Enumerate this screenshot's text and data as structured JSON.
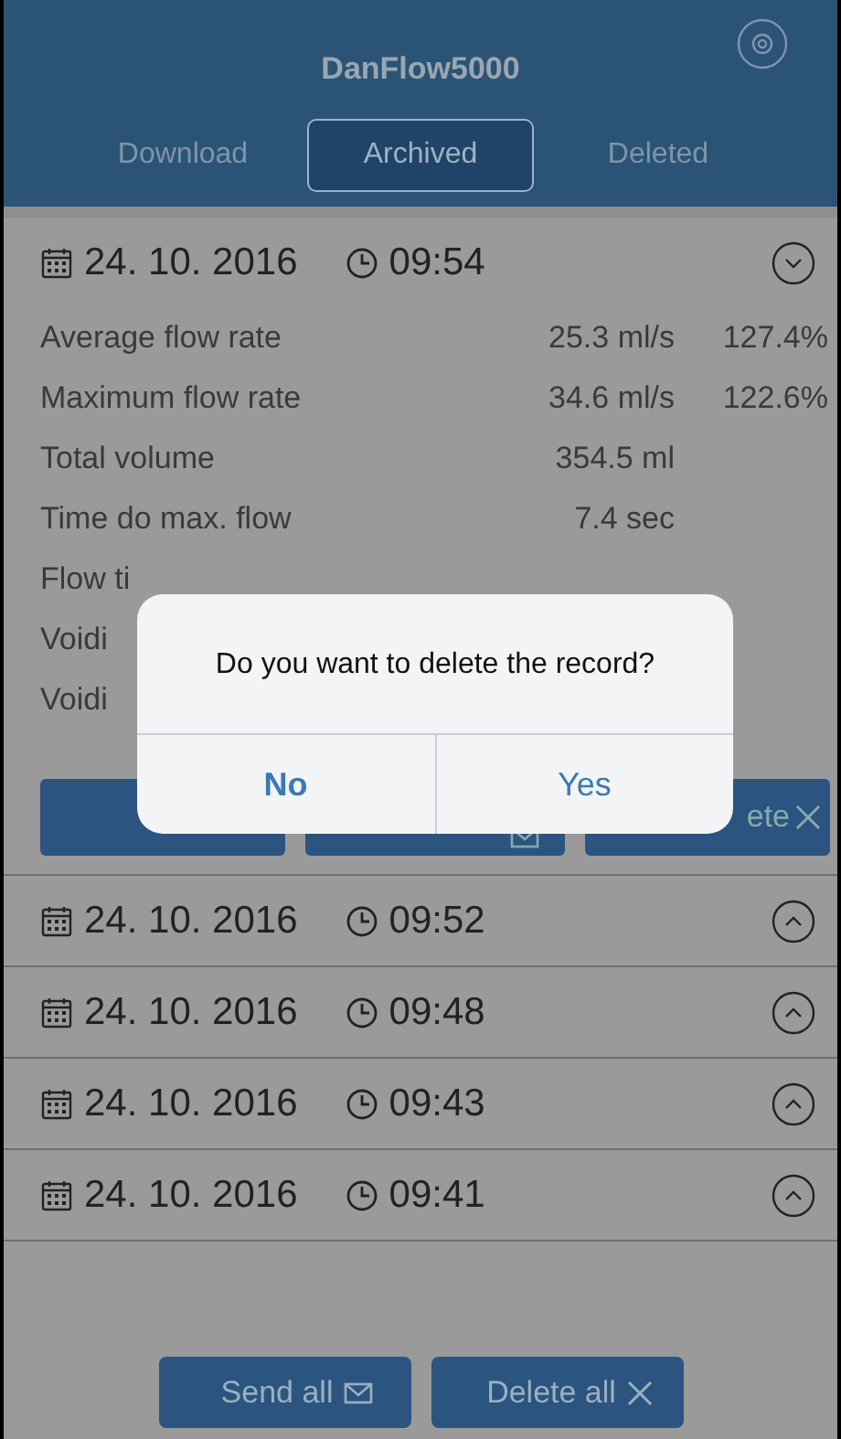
{
  "app": {
    "title": "DanFlow5000"
  },
  "tabs": [
    {
      "label": "Download",
      "selected": false
    },
    {
      "label": "Archived",
      "selected": true
    },
    {
      "label": "Deleted",
      "selected": false
    }
  ],
  "records": [
    {
      "date": "24. 10. 2016",
      "time": "09:54",
      "expanded": true,
      "rows": [
        {
          "label": "Average flow rate",
          "value": "25.3 ml/s",
          "percent": "127.4%"
        },
        {
          "label": "Maximum flow rate",
          "value": "34.6 ml/s",
          "percent": "122.6%"
        },
        {
          "label": "Total volume",
          "value": "354.5 ml"
        },
        {
          "label": "Time do max. flow",
          "value": "7.4 sec"
        },
        {
          "label": "Flow ti"
        },
        {
          "label": "Voidi"
        },
        {
          "label": "Voidi"
        }
      ],
      "actions": [
        {
          "kind": "plain"
        },
        {
          "kind": "mail"
        },
        {
          "label": "ete",
          "kind": "close"
        }
      ]
    },
    {
      "date": "24. 10. 2016",
      "time": "09:52",
      "expanded": false
    },
    {
      "date": "24. 10. 2016",
      "time": "09:48",
      "expanded": false
    },
    {
      "date": "24. 10. 2016",
      "time": "09:43",
      "expanded": false
    },
    {
      "date": "24. 10. 2016",
      "time": "09:41",
      "expanded": false
    }
  ],
  "footer_buttons": [
    {
      "label": "Send all",
      "kind": "mail"
    },
    {
      "label": "Delete all",
      "kind": "close"
    }
  ],
  "dialog": {
    "message": "Do you want to delete the record?",
    "buttons": [
      "No",
      "Yes"
    ]
  }
}
